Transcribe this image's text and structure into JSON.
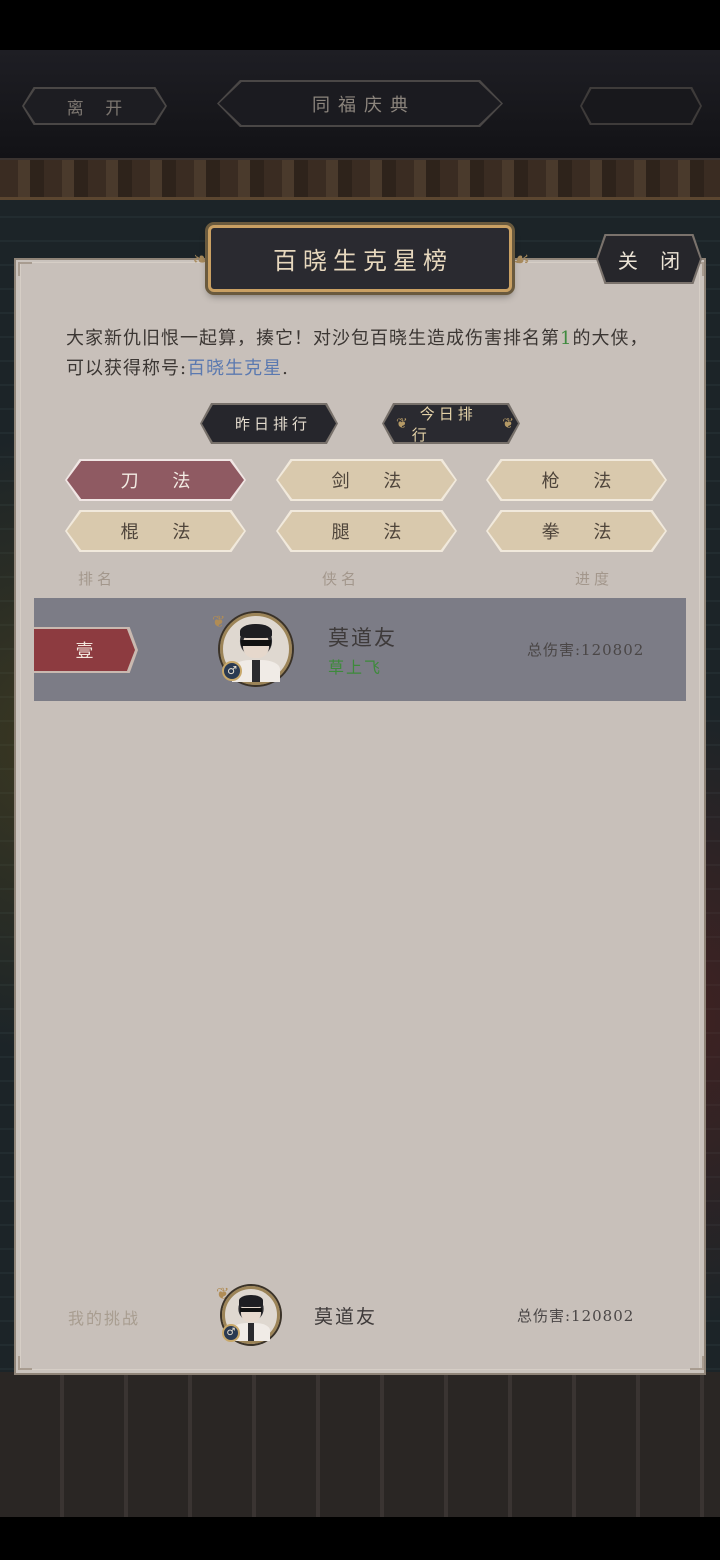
{
  "topbar": {
    "leave_label": "离 开",
    "event_label": "同福庆典",
    "right_label": ""
  },
  "panel": {
    "title": "百晓生克星榜",
    "close_label": "关 闭"
  },
  "description": {
    "part1": "大家新仇旧恨一起算，揍它！对沙包百晓生造成伤害排名第",
    "rank_number": "1",
    "part2": "的大侠，可以获得称号:",
    "reward_title": "百晓生克星",
    "end": "."
  },
  "rank_tabs": {
    "yesterday": "昨日排行",
    "today": "今日排行",
    "today_deco_left": "❦",
    "today_deco_right": "❦"
  },
  "categories": [
    {
      "label": "刀 法",
      "active": true
    },
    {
      "label": "剑 法",
      "active": false
    },
    {
      "label": "枪 法",
      "active": false
    },
    {
      "label": "棍 法",
      "active": false
    },
    {
      "label": "腿 法",
      "active": false
    },
    {
      "label": "拳 法",
      "active": false
    }
  ],
  "columns": {
    "rank": "排名",
    "name": "侠名",
    "progress": "进度"
  },
  "rows": [
    {
      "rank": "壹",
      "name": "莫道友",
      "title": "草上飞",
      "gender_icon": "♂",
      "damage": "总伤害:120802"
    }
  ],
  "my_challenge": {
    "label": "我的挑战",
    "name": "莫道友",
    "gender_icon": "♂",
    "damage": "总伤害:120802"
  },
  "colors": {
    "active_category": "#8f5a62",
    "category": "#d9c9ad",
    "rank_badge": "#8d3b40",
    "highlight_text": "#5b79b0",
    "title_green": "#3d8a3b",
    "panel": "#c8c0ba"
  }
}
